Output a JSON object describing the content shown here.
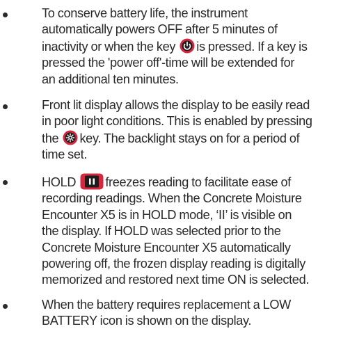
{
  "bullets": [
    {
      "lines": [
        "To conserve battery life, the instrument",
        "automatically powers OFF after 5 minutes of",
        [
          "inactivity or when the key ",
          "is pressed. If a key is"
        ],
        "pressed the 'power off'-time will be extended for",
        "an additional ten minutes."
      ],
      "icon": "power-key-icon"
    },
    {
      "lines": [
        "Front lit display allows the display to be easily read",
        "in poor light conditions. This is enabled by pressing",
        [
          "the ",
          "key. The backlight stays on for a period of"
        ],
        "time set."
      ],
      "icon": "backlight-key-icon"
    },
    {
      "lines": [
        [
          "HOLD ",
          "freezes reading to facilitate ease of"
        ],
        "recording readings. When the Concrete Moisture",
        "Encounter X5 is in HOLD mode, ‘II’ is visible on",
        "the display. If  HOLD was selected prior to the",
        "Concrete Moisture Encounter X5 automatically",
        "powering off, the frozen display reading is digitally",
        "memorized and restored next time ON is selected."
      ],
      "icon": "hold-key-icon"
    },
    {
      "lines": [
        "When the battery requires replacement a LOW",
        "BATTERY icon is shown on the display."
      ]
    }
  ],
  "colors": {
    "text": "#2a2a2a",
    "key_red": "#d7263d",
    "key_dark": "#1c1c1c"
  }
}
